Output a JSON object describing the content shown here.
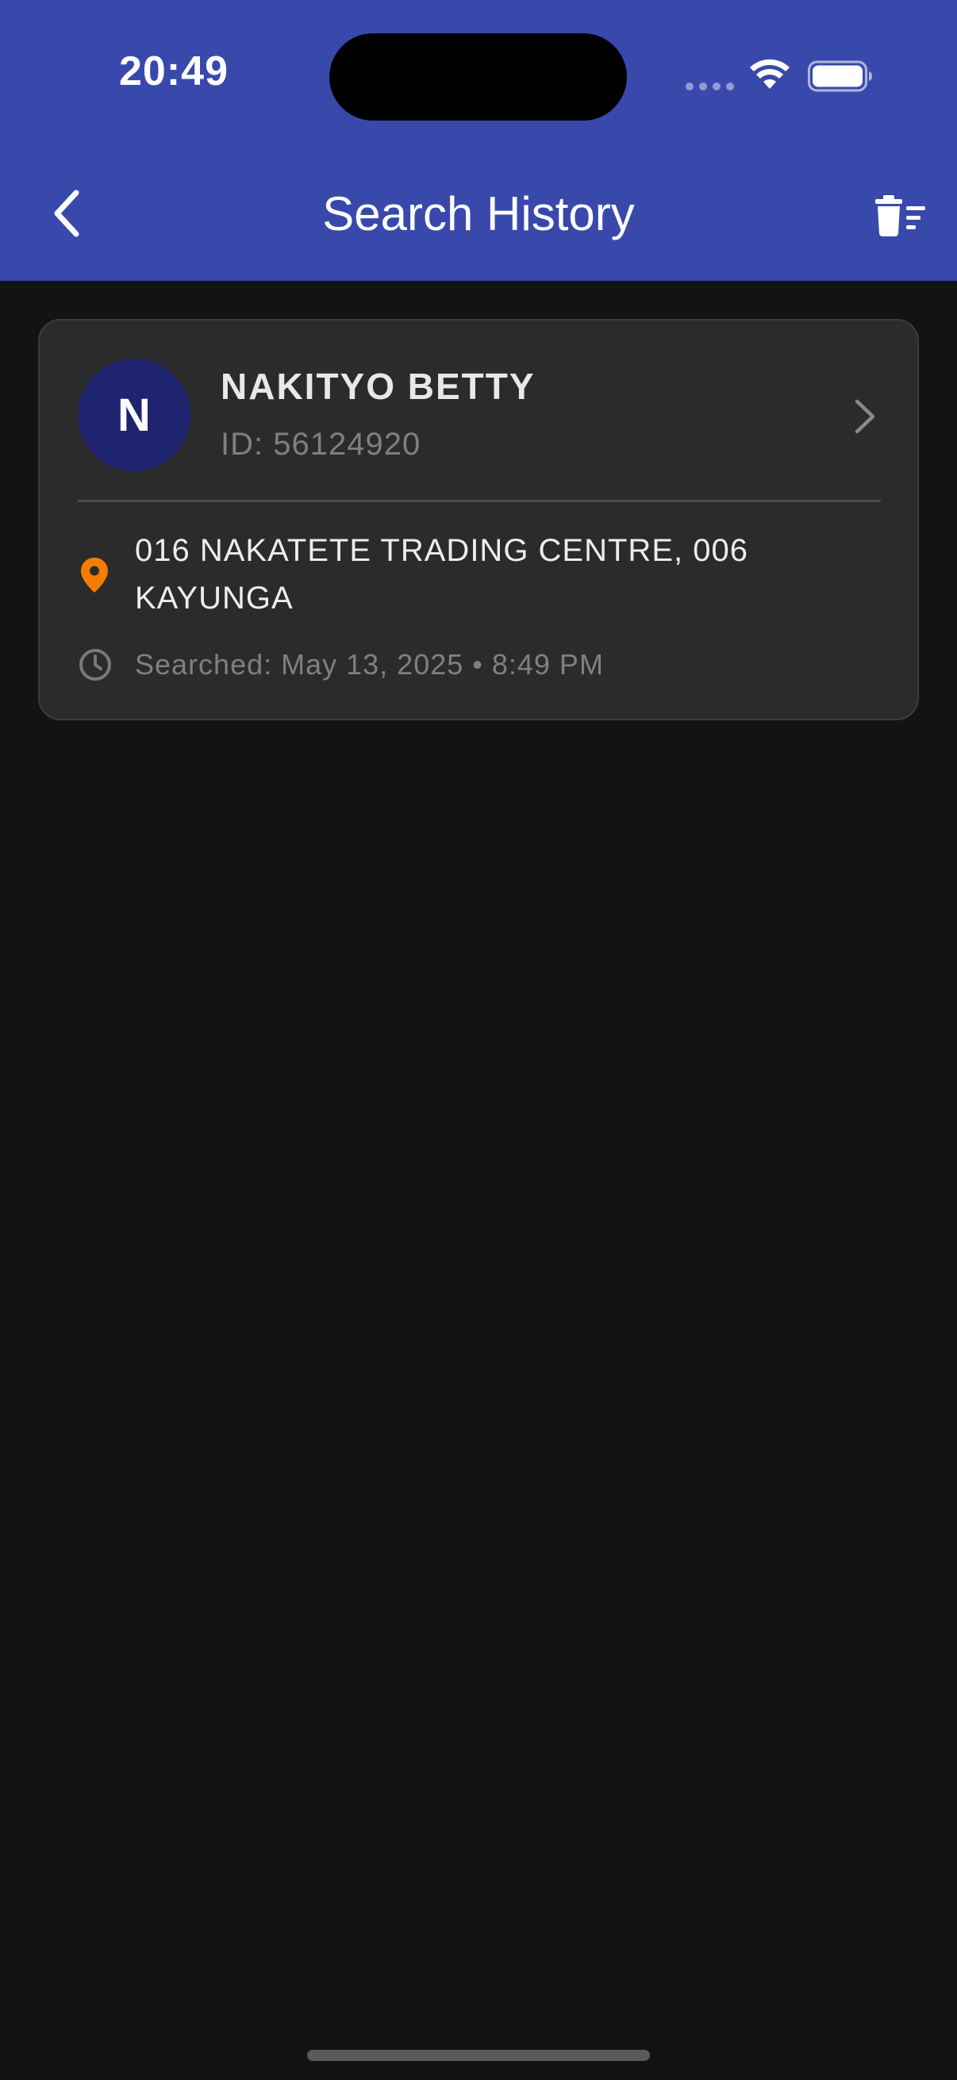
{
  "status_bar": {
    "time": "20:49"
  },
  "header": {
    "title": "Search History",
    "back_icon": "chevron-left-icon",
    "delete_icon": "trash-list-icon",
    "background_color": "#3949AB"
  },
  "history": [
    {
      "avatar_initial": "N",
      "name": "NAKITYO BETTY",
      "id_text": "ID: 56124920",
      "address": "016 NAKATETE TRADING CENTRE, 006 KAYUNGA",
      "searched_text": "Searched: May 13, 2025 • 8:49 PM"
    }
  ],
  "colors": {
    "background": "#131313",
    "card": "#2b2b2b",
    "avatar": "#1F2471",
    "location_pin": "#F57C00"
  }
}
